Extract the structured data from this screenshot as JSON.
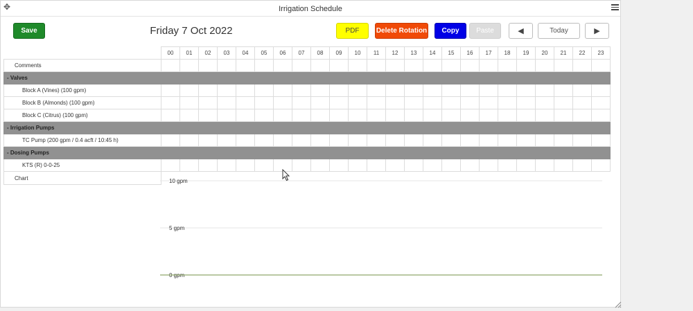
{
  "window": {
    "title": "Irrigation Schedule"
  },
  "toolbar": {
    "save_label": "Save",
    "date": "Friday 7 Oct 2022",
    "pdf_label": "PDF",
    "delete_label": "Delete Rotation",
    "copy_label": "Copy",
    "paste_label": "Paste",
    "prev_label": "◀",
    "today_label": "Today",
    "next_label": "▶"
  },
  "schedule": {
    "hours": [
      "00",
      "01",
      "02",
      "03",
      "04",
      "05",
      "06",
      "07",
      "08",
      "09",
      "10",
      "11",
      "12",
      "13",
      "14",
      "15",
      "16",
      "17",
      "18",
      "19",
      "20",
      "21",
      "22",
      "23"
    ],
    "comments_label": "Comments",
    "sections": [
      {
        "title": "- Valves",
        "rows": [
          "Block A (Vines) (100 gpm)",
          "Block B (Almonds) (100 gpm)",
          "Block C (Citrus) (100 gpm)"
        ]
      },
      {
        "title": "- Irrigation Pumps",
        "rows": [
          "TC Pump (200 gpm / 0.4 acft / 10:45 h)"
        ]
      },
      {
        "title": "- Dosing Pumps",
        "rows": [
          "KTS (R) 0-0-25"
        ]
      }
    ],
    "chart_label": "Chart"
  },
  "chart_data": {
    "type": "line",
    "yticks": [
      "10 gpm",
      "5 gpm",
      "0 gpm"
    ],
    "ylim": [
      0,
      10
    ],
    "series": [
      {
        "values": [
          0,
          0
        ]
      }
    ],
    "colors": {
      "grid": "#e6e6e6",
      "line": "#8fa86a"
    }
  },
  "colors": {
    "save": "#1f8a2a",
    "pdf": "#ffff00",
    "delete": "#f04a07",
    "copy": "#0000e6",
    "paste": "#dcdcdc",
    "section": "#919191"
  }
}
